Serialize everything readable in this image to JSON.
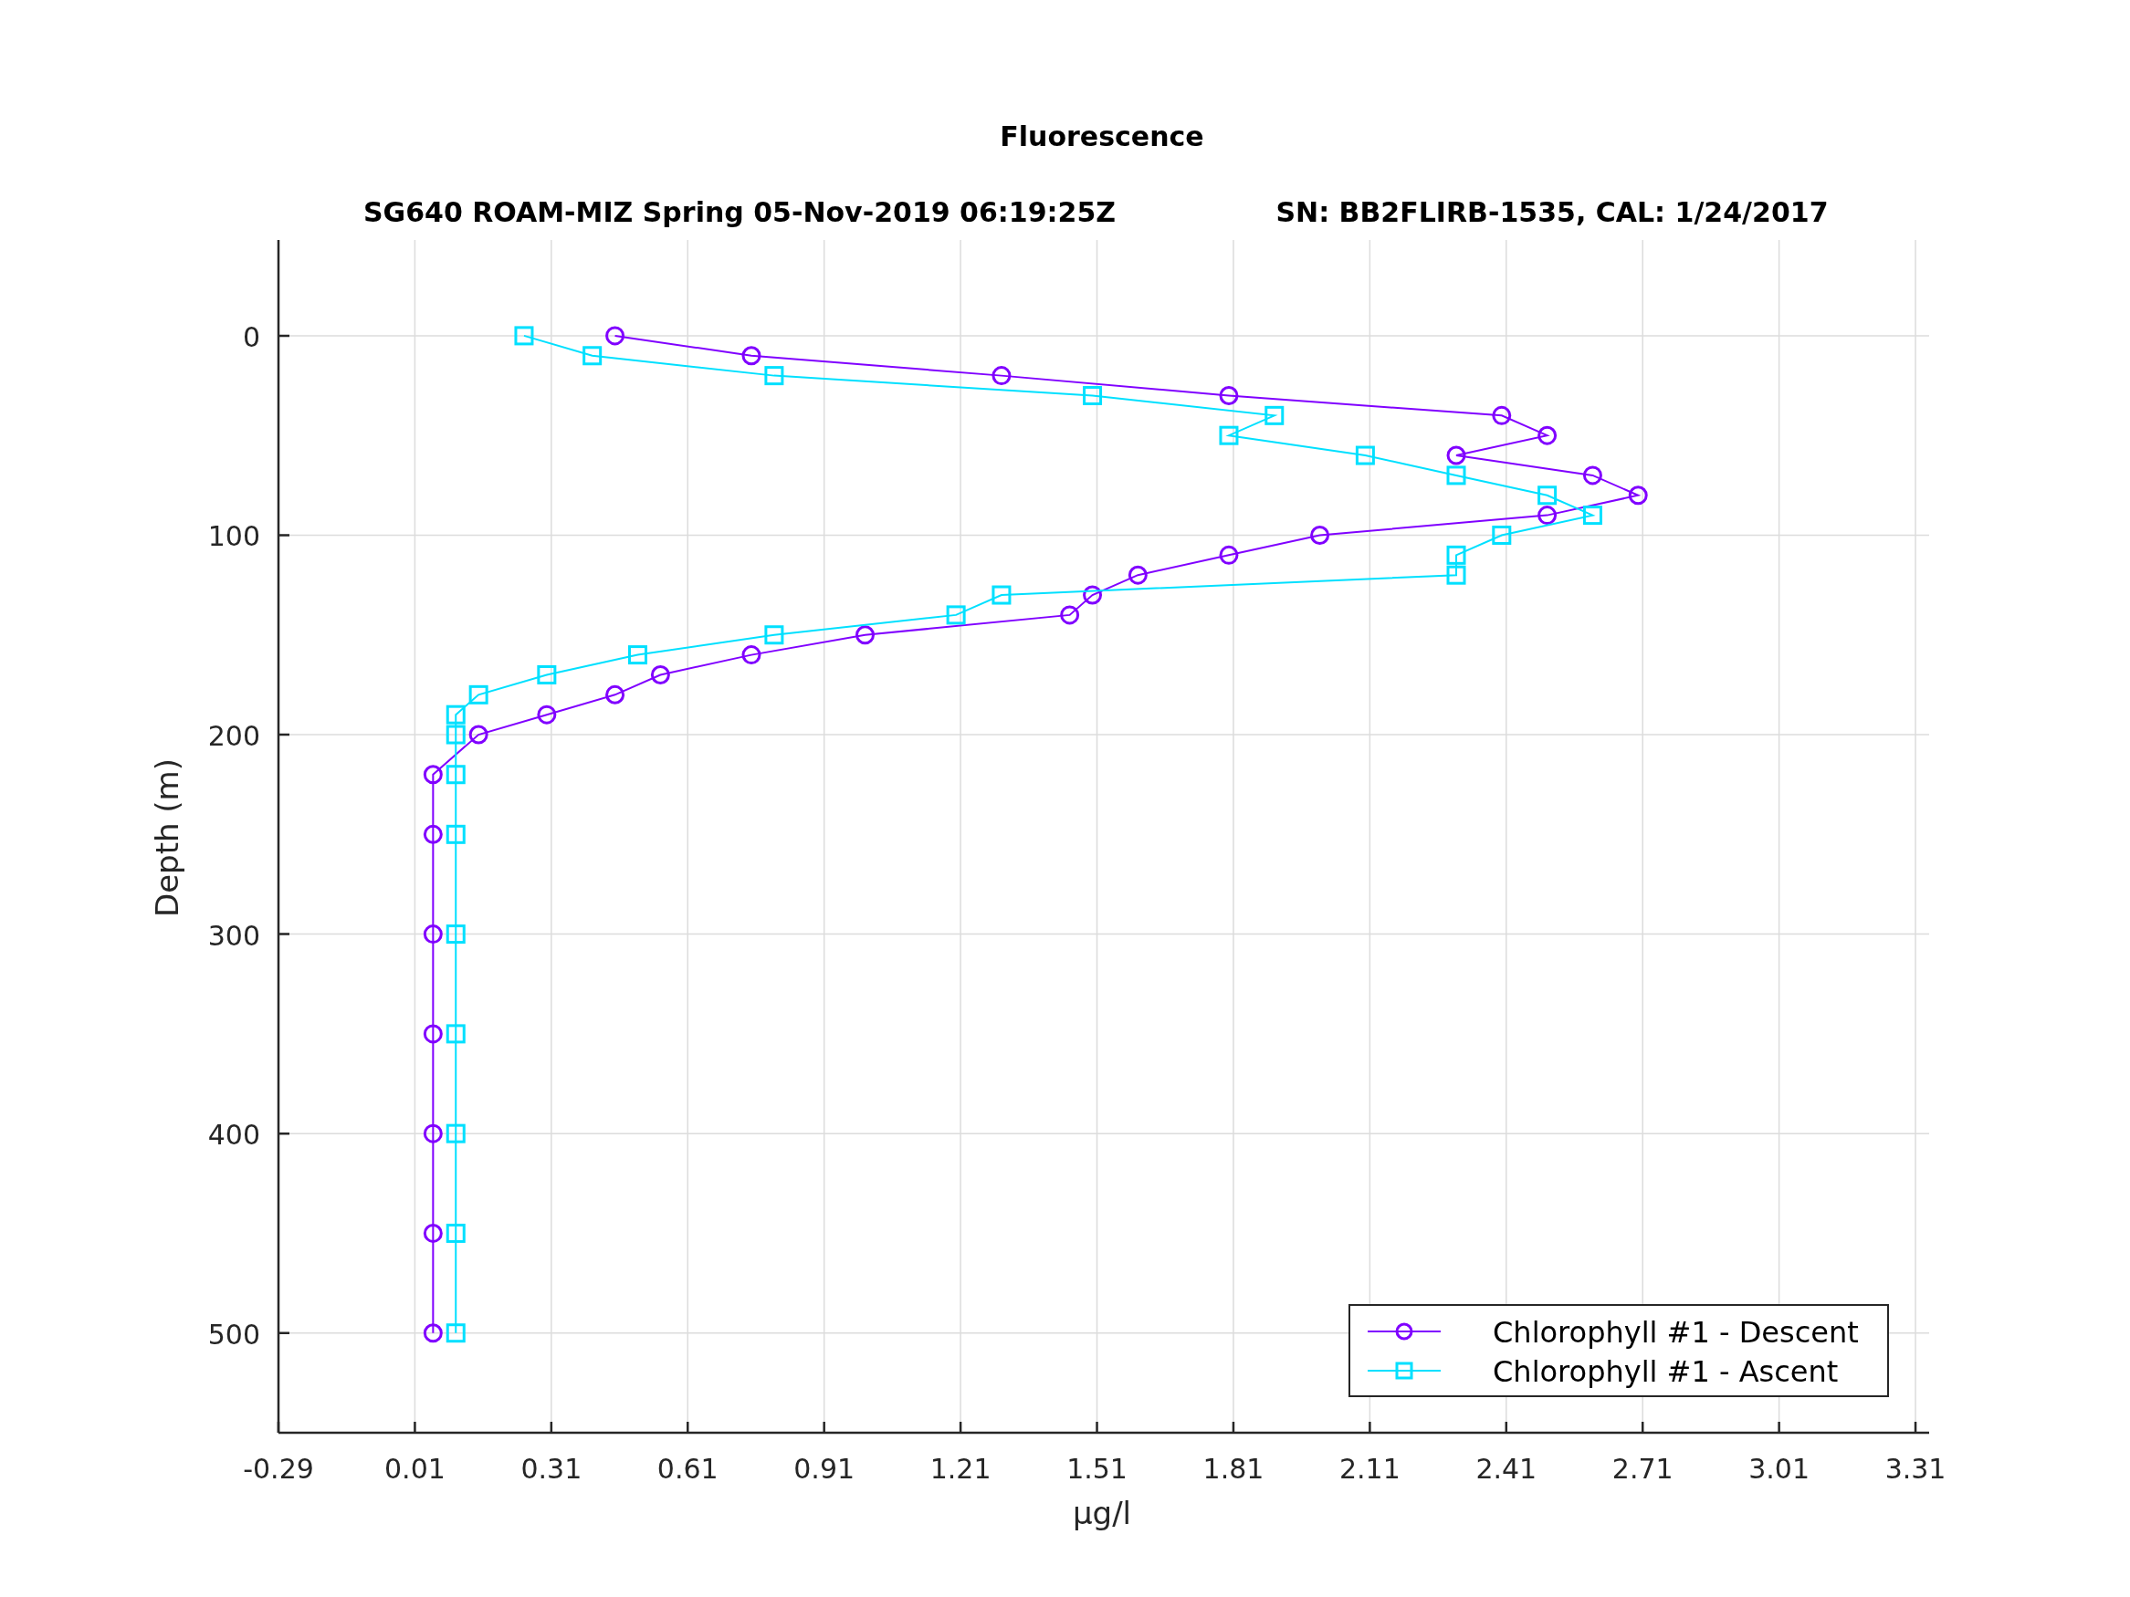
{
  "figure": {
    "title": "Fluorescence",
    "subtitle": "SG640 ROAM-MIZ Spring 05-Nov-2019 06:19:25Z",
    "sensor": "SN: BB2FLIRB-1535, CAL: 1/24/2017",
    "chart_data": {
      "type": "line",
      "xlabel": "μg/l",
      "ylabel": "Depth (m)",
      "grid": true,
      "legend": true,
      "xlim": [
        -0.29,
        3.34
      ],
      "ylim": [
        550,
        -48
      ],
      "xticks": [
        -0.29,
        0.01,
        0.31,
        0.61,
        0.91,
        1.21,
        1.51,
        1.81,
        2.11,
        2.41,
        2.71,
        3.01,
        3.31
      ],
      "yticks": [
        0,
        100,
        200,
        300,
        400,
        500
      ],
      "series": [
        {
          "name": "Chlorophyll #1 - Descent",
          "color": "#8000ff",
          "marker": "o",
          "x": [
            0.45,
            0.75,
            1.3,
            1.8,
            2.4,
            2.5,
            2.3,
            2.6,
            2.7,
            2.5,
            2.0,
            1.8,
            1.6,
            1.5,
            1.45,
            1.0,
            0.75,
            0.55,
            0.45,
            0.3,
            0.15,
            0.05,
            0.05,
            0.05,
            0.05,
            0.05,
            0.05,
            0.05
          ],
          "values": [
            0,
            10,
            20,
            30,
            40,
            50,
            60,
            70,
            80,
            90,
            100,
            110,
            120,
            130,
            140,
            150,
            160,
            170,
            180,
            190,
            200,
            220,
            250,
            300,
            350,
            400,
            450,
            500
          ]
        },
        {
          "name": "Chlorophyll #1 - Ascent",
          "color": "#00e0ff",
          "marker": "s",
          "x": [
            0.25,
            0.4,
            0.8,
            1.5,
            1.9,
            1.8,
            2.1,
            2.3,
            2.5,
            2.6,
            2.4,
            2.3,
            2.3,
            1.3,
            1.2,
            0.8,
            0.5,
            0.3,
            0.15,
            0.1,
            0.1,
            0.1,
            0.1,
            0.1,
            0.1,
            0.1,
            0.1,
            0.1
          ],
          "values": [
            0,
            10,
            20,
            30,
            40,
            50,
            60,
            70,
            80,
            90,
            100,
            110,
            120,
            130,
            140,
            150,
            160,
            170,
            180,
            190,
            200,
            220,
            250,
            300,
            350,
            400,
            450,
            500
          ]
        }
      ]
    }
  }
}
